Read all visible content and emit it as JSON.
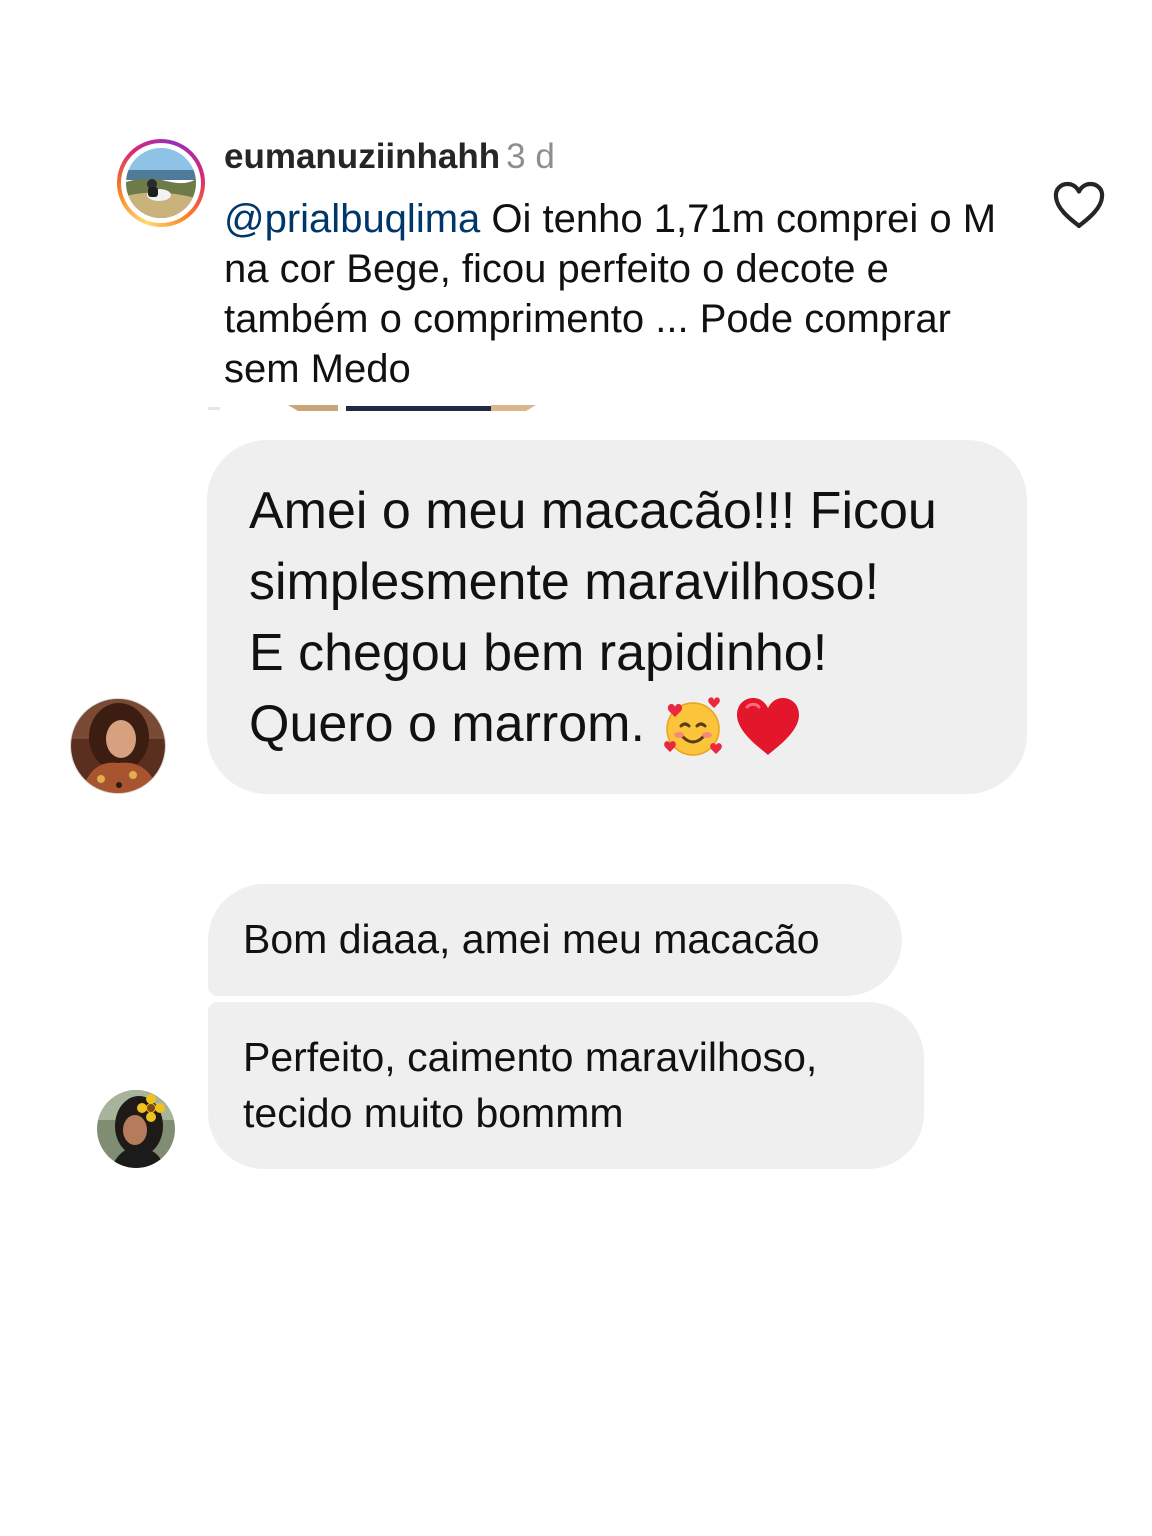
{
  "comment": {
    "username": "eumanuziinhahh",
    "time": "3 d",
    "mention": "@prialbuqlima",
    "text": " Oi tenho 1,71m comprei o M na cor Bege, ficou perfeito o decote e também o comprimento ... Pode comprar sem Medo",
    "like_icon": "heart-outline-icon",
    "ring_colors": [
      "#feda75",
      "#fa7e1e",
      "#d62976",
      "#962fbf"
    ],
    "mention_color": "#00376b"
  },
  "messages": [
    {
      "lines": [
        "Amei o meu macacão!!! Ficou",
        "simplesmente maravilhoso!",
        "E chegou bem rapidinho!",
        "Quero o marrom."
      ],
      "emojis": [
        "smiling-face-with-hearts-icon",
        "red-heart-icon"
      ]
    },
    {
      "text": "Bom diaaa, amei meu macacão"
    },
    {
      "lines": [
        "Perfeito, caimento maravilhoso,",
        "tecido muito bommm"
      ]
    }
  ],
  "colors": {
    "bubble": "#efefef",
    "text": "#111111",
    "muted": "#8e8e8e"
  }
}
